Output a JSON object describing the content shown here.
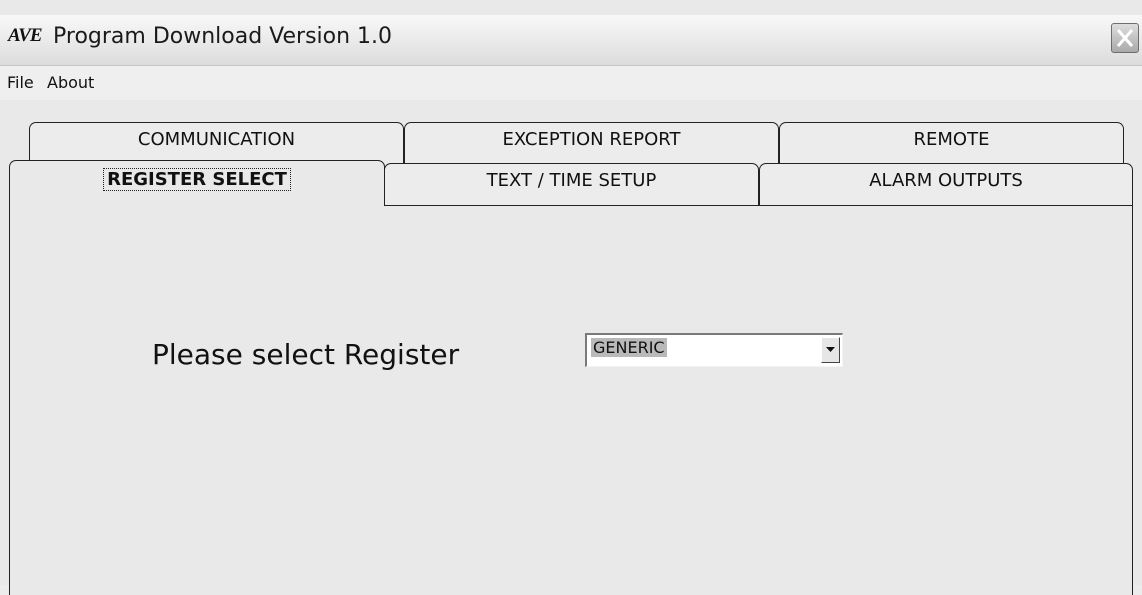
{
  "window": {
    "logo_text": "AVE",
    "title": "Program Download Version 1.0",
    "close_icon": "close-x-icon"
  },
  "menu": {
    "items": [
      "File",
      "About"
    ]
  },
  "tabs": {
    "back_row": [
      "COMMUNICATION",
      "EXCEPTION REPORT",
      "REMOTE"
    ],
    "front_row": [
      "REGISTER SELECT",
      "TEXT / TIME SETUP",
      "ALARM OUTPUTS"
    ],
    "active": "REGISTER SELECT"
  },
  "register_panel": {
    "prompt": "Please select Register",
    "selected_value": "GENERIC",
    "dropdown_icon": "chevron-down-icon"
  }
}
